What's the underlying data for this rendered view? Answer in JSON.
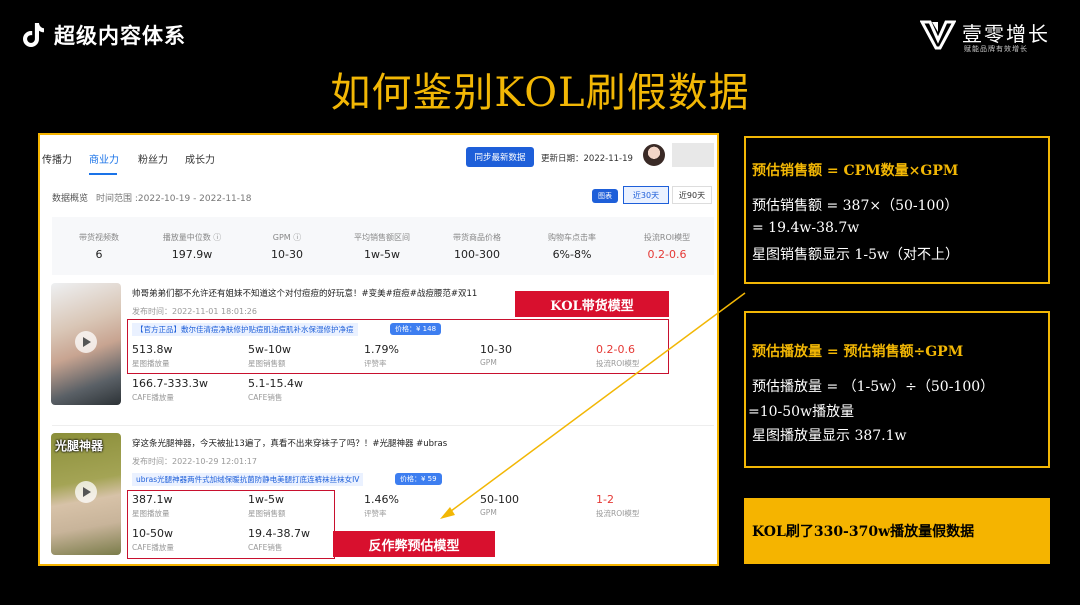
{
  "header": {
    "series_title": "超级内容体系",
    "brand_name": "壹零增长",
    "brand_slogan": "赋能品牌有效增长"
  },
  "main_title": "如何鉴别KOL刷假数据",
  "panel": {
    "tabs": [
      "传播力",
      "商业力",
      "粉丝力",
      "成长力"
    ],
    "active_tab": "商业力",
    "sync_button": "同步最新数据",
    "update_date": "更新日期：2022-11-19",
    "overview_label": "数据概览",
    "overview_range": "时间范围 :2022-10-19 - 2022-11-18",
    "range_options": [
      "图表",
      "近30天",
      "近90天"
    ],
    "metrics": [
      {
        "label": "带货视频数",
        "value": "6"
      },
      {
        "label": "播放量中位数 ⓘ",
        "value": "197.9w"
      },
      {
        "label": "GPM ⓘ",
        "value": "10-30"
      },
      {
        "label": "平均销售额区间",
        "value": "1w-5w"
      },
      {
        "label": "带货商品价格",
        "value": "100-300"
      },
      {
        "label": "购物车点击率",
        "value": "6%-8%"
      },
      {
        "label": "投流ROI模型",
        "value": "0.2-0.6"
      }
    ],
    "videos": [
      {
        "title": "帅哥弟弟们都不允许还有姐妹不知道这个对付痘痘的好玩意！#变美#痘痘#战痘腰范#双11",
        "date": "发布时间：2022-11-01 18:01:26",
        "product": "【官方正品】敷尔佳清痘净肤修护贴痘肌油痘肌补水保湿修护净痘",
        "price": "价格：¥ 148",
        "stats": [
          {
            "value": "513.8w",
            "label": "星图播放量"
          },
          {
            "value": "5w-10w",
            "label": "星图销售额"
          },
          {
            "value": "1.79%",
            "label": "评赞率"
          },
          {
            "value": "10-30",
            "label": "GPM"
          },
          {
            "value": "0.2-0.6",
            "label": "投流ROI模型"
          },
          {
            "value": "166.7-333.3w",
            "label": "CAFE播放量"
          },
          {
            "value": "5.1-15.4w",
            "label": "CAFE销售"
          }
        ],
        "box_label": "KOL带货模型"
      },
      {
        "title": "穿这条光腿神器，今天被扯13遍了，真看不出来穿袜子了吗？！#光腿神器 #ubras",
        "date": "发布时间：2022-10-29 12:01:17",
        "product": "ubras光腿神器两件式加绒保暖抗菌防静电美腿打底连裤袜丝袜女IV",
        "price": "价格：¥ 59",
        "thumb_label": "光腿神器",
        "stats": [
          {
            "value": "387.1w",
            "label": "星图播放量"
          },
          {
            "value": "1w-5w",
            "label": "星图销售额"
          },
          {
            "value": "1.46%",
            "label": "评赞率"
          },
          {
            "value": "50-100",
            "label": "GPM"
          },
          {
            "value": "1-2",
            "label": "投流ROI模型"
          },
          {
            "value": "10-50w",
            "label": "CAFE播放量"
          },
          {
            "value": "19.4-38.7w",
            "label": "CAFE销售"
          }
        ],
        "box_label": "反作弊预估模型"
      }
    ]
  },
  "boxes": {
    "sales": {
      "heading": "预估销售额 = CPM数量×GPM",
      "lines": [
        "预估销售额 = 387×（50-100）",
        "= 19.4w-38.7w",
        "星图销售额显示 1-5w（对不上）"
      ]
    },
    "plays": {
      "heading": "预估播放量 = 预估销售额÷GPM",
      "lines": [
        "预估播放量 = （1-5w）÷（50-100）",
        "=10-50w播放量",
        "星图播放量显示 387.1w"
      ]
    },
    "conclusion": "KOL刷了330-370w播放量假数据"
  },
  "colors": {
    "accent": "#f2b705",
    "highlight_red": "#d8102e",
    "link_blue": "#1e5fd9",
    "negative_red": "#e53935"
  }
}
